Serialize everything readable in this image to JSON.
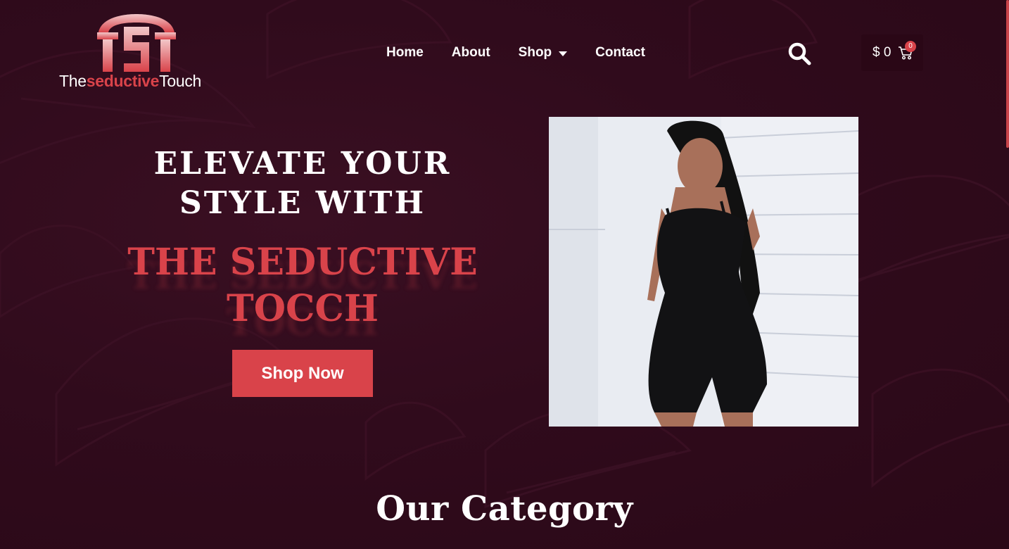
{
  "header": {
    "logo": {
      "mark_text": "TST",
      "text_prefix": "The",
      "text_accent": "seductive",
      "text_suffix": "Touch"
    },
    "nav": [
      {
        "label": "Home"
      },
      {
        "label": "About"
      },
      {
        "label": "Shop",
        "has_dropdown": true
      },
      {
        "label": "Contact"
      }
    ],
    "search_icon": "search-icon",
    "cart": {
      "amount": "$ 0",
      "count": "0",
      "icon": "cart-icon"
    }
  },
  "hero": {
    "heading_line1": "ELEVATE YOUR",
    "heading_line2": "STYLE WITH",
    "brand_line1": "THE SEDUCTIVE",
    "brand_line2": "TOCCH",
    "cta_label": "Shop Now"
  },
  "category_section": {
    "title": "Our Category"
  },
  "colors": {
    "background": "#2f0a1b",
    "accent": "#d9434a",
    "text": "#ffffff"
  }
}
